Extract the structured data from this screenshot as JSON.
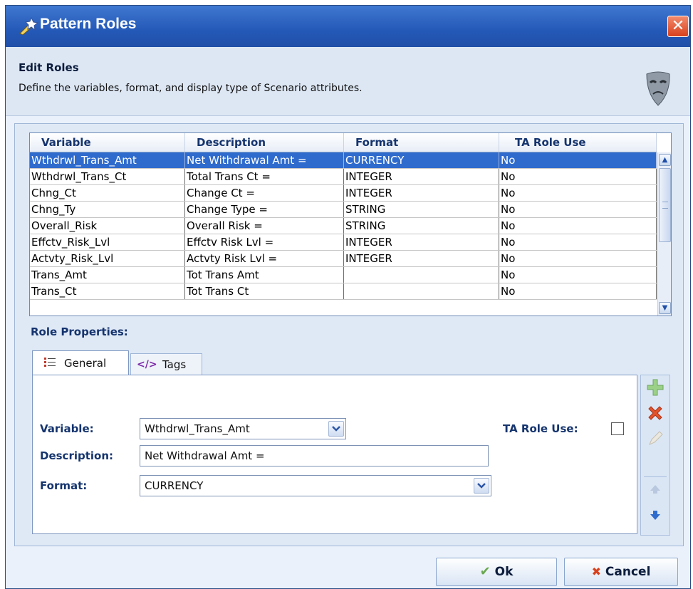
{
  "window": {
    "title": "Pattern Roles"
  },
  "header": {
    "title": "Edit Roles",
    "description": "Define the variables, format, and display type of Scenario attributes."
  },
  "grid": {
    "columns": [
      "Variable",
      "Description",
      "Format",
      "TA Role Use"
    ],
    "rows": [
      [
        "Wthdrwl_Trans_Amt",
        "Net Withdrawal Amt =",
        "CURRENCY",
        "No"
      ],
      [
        "Wthdrwl_Trans_Ct",
        "Total Trans Ct =",
        "INTEGER",
        "No"
      ],
      [
        "Chng_Ct",
        "Change Ct =",
        "INTEGER",
        "No"
      ],
      [
        "Chng_Ty",
        "Change Type =",
        "STRING",
        "No"
      ],
      [
        "Overall_Risk",
        "Overall Risk =",
        "STRING",
        "No"
      ],
      [
        "Effctv_Risk_Lvl",
        "Effctv Risk Lvl =",
        "INTEGER",
        "No"
      ],
      [
        "Actvty_Risk_Lvl",
        "Actvty Risk Lvl =",
        "INTEGER",
        "No"
      ],
      [
        "Trans_Amt",
        "Tot Trans Amt",
        "",
        "No"
      ],
      [
        "Trans_Ct",
        "Tot Trans Ct",
        "",
        "No"
      ]
    ],
    "selected_row": 0
  },
  "role_properties": {
    "label": "Role Properties:",
    "tabs": [
      {
        "label": "General",
        "icon": "list-icon",
        "active": true
      },
      {
        "label": "Tags",
        "icon": "code-tag-icon",
        "active": false
      }
    ],
    "variable_label": "Variable:",
    "variable_value": "Wthdrwl_Trans_Amt",
    "description_label": "Description:",
    "description_value": "Net Withdrawal Amt =",
    "format_label": "Format:",
    "format_value": "CURRENCY",
    "ta_role_use_label": "TA Role Use:",
    "ta_role_use_checked": false
  },
  "buttons": {
    "ok": "Ok",
    "cancel": "Cancel"
  },
  "colors": {
    "title_bar": "#2559b8",
    "selection": "#2f6bcd",
    "label_blue": "#15346e",
    "close": "#d9411c"
  }
}
